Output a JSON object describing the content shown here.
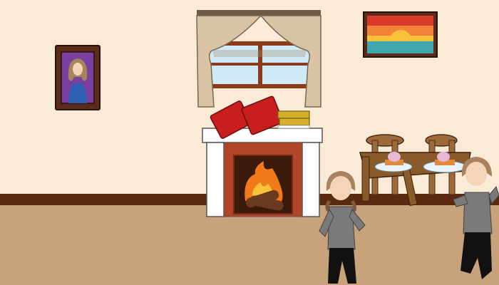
{
  "scene": {
    "colors": {
      "wall": "#FAEBD7",
      "baseboard": "#5B2A0E",
      "floor": "#C8A27A",
      "frame_dark": "#5A2D1A",
      "portrait_bg": "#7B3FA0",
      "window_frame": "#8B3A1A",
      "sky": "#CFE9F7",
      "curtain": "#D8C3A5",
      "mantel_white": "#FFFFFF",
      "firebox": "#B0452A",
      "firebox_inner": "#3A1A0A",
      "fire_orange": "#F07A1A",
      "fire_yellow": "#F8C23A",
      "log": "#6B3A1E",
      "book_red": "#C81E1E",
      "book_gold": "#D4B02A",
      "table_wood": "#8B5A2B",
      "stool_wood": "#9C6A3A",
      "plate": "#E9F2F7",
      "cupcake_pink": "#E7B8D6",
      "shirt": "#7A7A7A",
      "pants": "#111111",
      "hair": "#A9825E",
      "skin": "#F5D5B8",
      "sunset_red": "#D93A2A",
      "sunset_orange": "#F3823A",
      "sunset_yellow": "#F8C23A",
      "sea": "#3FA7B0"
    },
    "objects": [
      {
        "name": "portrait-painting",
        "icon": "portrait-of-woman"
      },
      {
        "name": "window-with-curtains",
        "icon": "window"
      },
      {
        "name": "sunset-painting",
        "icon": "sunset-over-sea"
      },
      {
        "name": "fireplace",
        "icon": "fireplace-with-fire"
      },
      {
        "name": "books-on-mantel",
        "icon": "books"
      },
      {
        "name": "table-with-cupcakes",
        "icon": "dessert-table"
      },
      {
        "name": "girl-character-center",
        "icon": "girl-dancing"
      },
      {
        "name": "girl-character-right",
        "icon": "girl-waving"
      }
    ]
  }
}
